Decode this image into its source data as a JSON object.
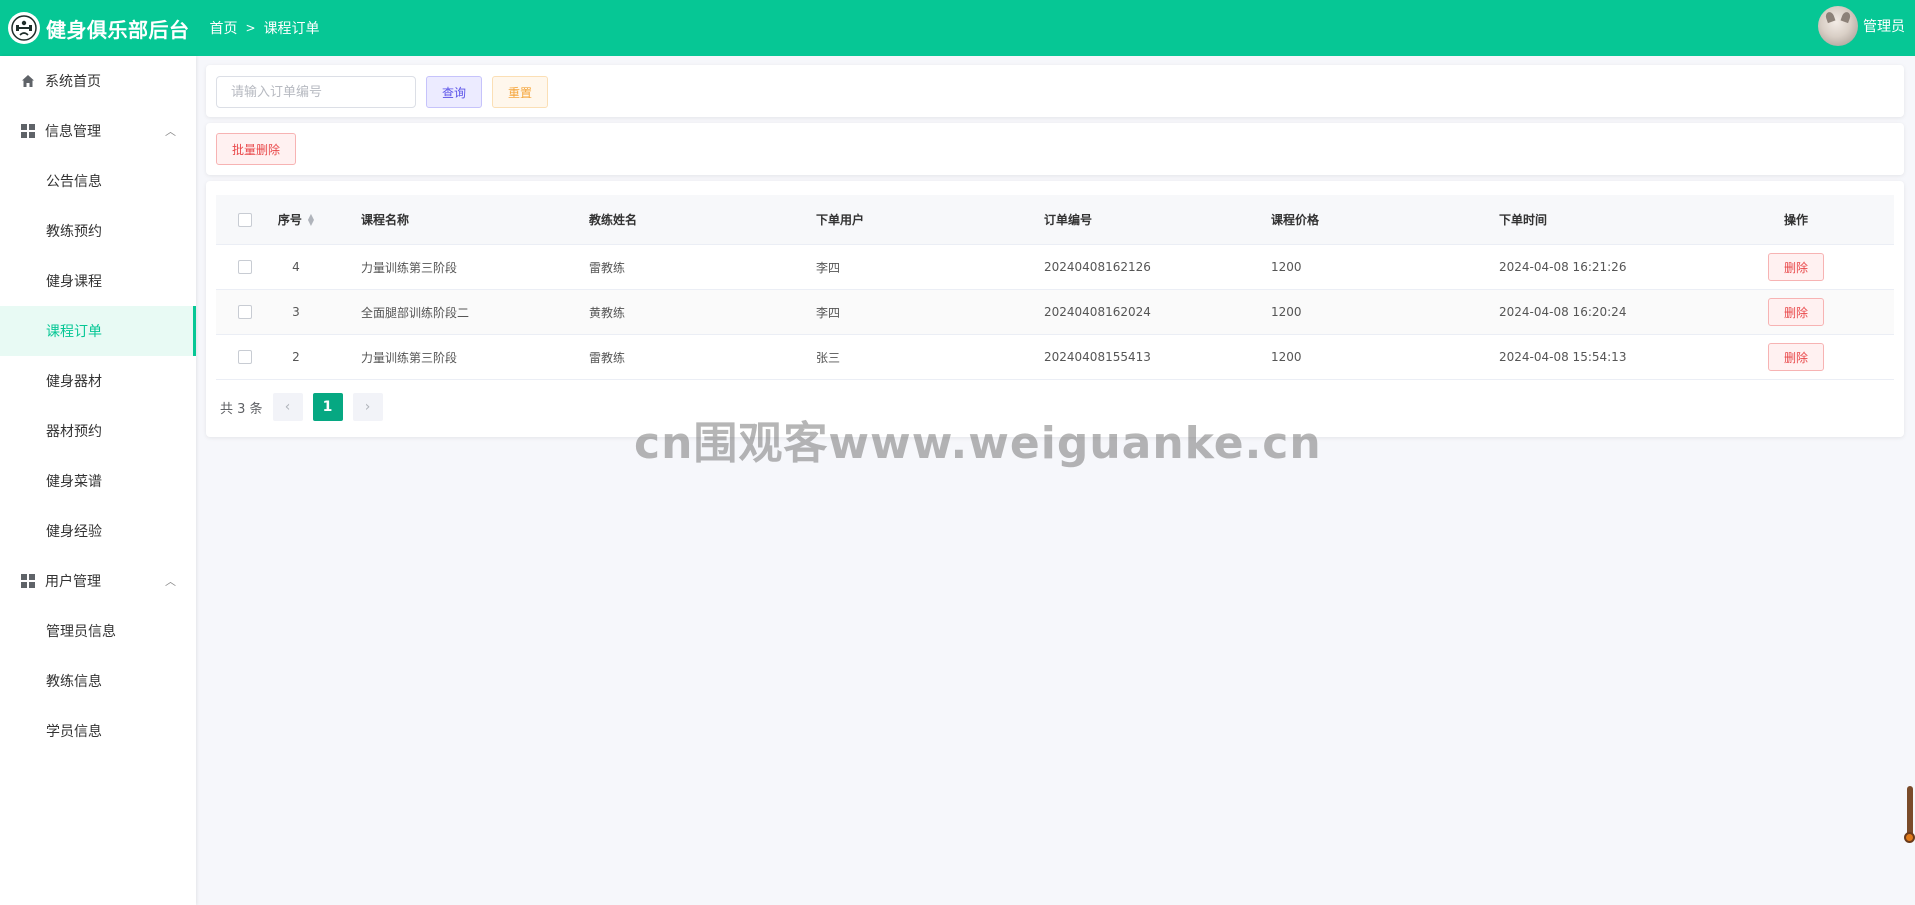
{
  "app": {
    "title": "健身俱乐部后台"
  },
  "breadcrumb": {
    "home": "首页",
    "current": "课程订单"
  },
  "user": {
    "name": "管理员"
  },
  "sidebar": {
    "items": [
      {
        "label": "系统首页",
        "icon": "home-icon"
      },
      {
        "label": "信息管理",
        "icon": "grid-icon",
        "group": true
      },
      {
        "label": "公告信息"
      },
      {
        "label": "教练预约"
      },
      {
        "label": "健身课程"
      },
      {
        "label": "课程订单",
        "active": true
      },
      {
        "label": "健身器材"
      },
      {
        "label": "器材预约"
      },
      {
        "label": "健身菜谱"
      },
      {
        "label": "健身经验"
      },
      {
        "label": "用户管理",
        "icon": "grid-icon",
        "group": true
      },
      {
        "label": "管理员信息"
      },
      {
        "label": "教练信息"
      },
      {
        "label": "学员信息"
      }
    ]
  },
  "search": {
    "placeholder": "请输入订单编号",
    "query_label": "查询",
    "reset_label": "重置"
  },
  "actions": {
    "batch_delete_label": "批量删除"
  },
  "table": {
    "columns": [
      "序号",
      "课程名称",
      "教练姓名",
      "下单用户",
      "订单编号",
      "课程价格",
      "下单时间",
      "操作"
    ],
    "rows": [
      {
        "id": "4",
        "course": "力量训练第三阶段",
        "coach": "雷教练",
        "user": "李四",
        "order_no": "20240408162126",
        "price": "1200",
        "time": "2024-04-08 16:21:26",
        "op": "删除"
      },
      {
        "id": "3",
        "course": "全面腿部训练阶段二",
        "coach": "黄教练",
        "user": "李四",
        "order_no": "20240408162024",
        "price": "1200",
        "time": "2024-04-08 16:20:24",
        "op": "删除"
      },
      {
        "id": "2",
        "course": "力量训练第三阶段",
        "coach": "雷教练",
        "user": "张三",
        "order_no": "20240408155413",
        "price": "1200",
        "time": "2024-04-08 15:54:13",
        "op": "删除"
      }
    ]
  },
  "pagination": {
    "total_text": "共 3 条",
    "current_page": "1",
    "prev": "‹",
    "next": "›"
  },
  "watermark": "cn围观客www.weiguanke.cn",
  "colors": {
    "primary": "#06c795",
    "danger": "#e9484a",
    "query": "#5a52e8",
    "reset": "#f5a53a"
  }
}
